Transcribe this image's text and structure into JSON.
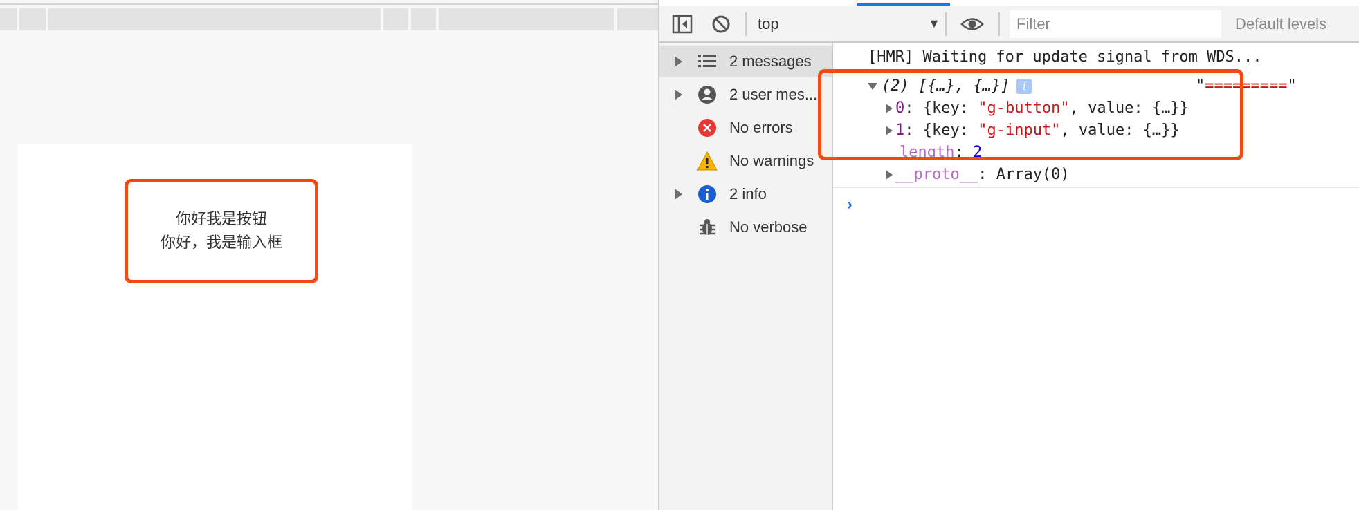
{
  "page": {
    "demo_lines": [
      "你好我是按钮",
      "你好，我是输入框"
    ]
  },
  "devtools": {
    "toolbar": {
      "context": "top",
      "filter_placeholder": "Filter",
      "levels_label": "Default levels"
    },
    "sidebar": {
      "items": [
        {
          "label": "2 messages",
          "icon": "list-icon",
          "expandable": true
        },
        {
          "label": "2 user mes...",
          "icon": "user-icon",
          "expandable": true
        },
        {
          "label": "No errors",
          "icon": "error-icon",
          "expandable": false
        },
        {
          "label": "No warnings",
          "icon": "warning-icon",
          "expandable": false
        },
        {
          "label": "2 info",
          "icon": "info-icon",
          "expandable": true
        },
        {
          "label": "No verbose",
          "icon": "bug-icon",
          "expandable": false
        }
      ]
    },
    "console": {
      "hmr_line": "[HMR] Waiting for update signal from WDS...",
      "array_summary": "(2) [{…}, {…}]",
      "info_badge": "i",
      "log_string_open": "\"",
      "log_string_value": "=========",
      "log_string_close": "\"",
      "entries": [
        {
          "index": "0",
          "pre": ": {key: ",
          "key": "\"g-button\"",
          "post": ", value: {…}}"
        },
        {
          "index": "1",
          "pre": ": {key: ",
          "key": "\"g-input\"",
          "post": ", value: {…}}"
        }
      ],
      "length_key": "length",
      "length_sep": ": ",
      "length_value": "2",
      "proto_key": "__proto__",
      "proto_value": ": Array(0)",
      "prompt": "›"
    }
  },
  "colors": {
    "highlight": "#f24a12",
    "accent": "#1a73e8",
    "string": "#c41a16",
    "index": "#881391",
    "number": "#1c00cf"
  }
}
